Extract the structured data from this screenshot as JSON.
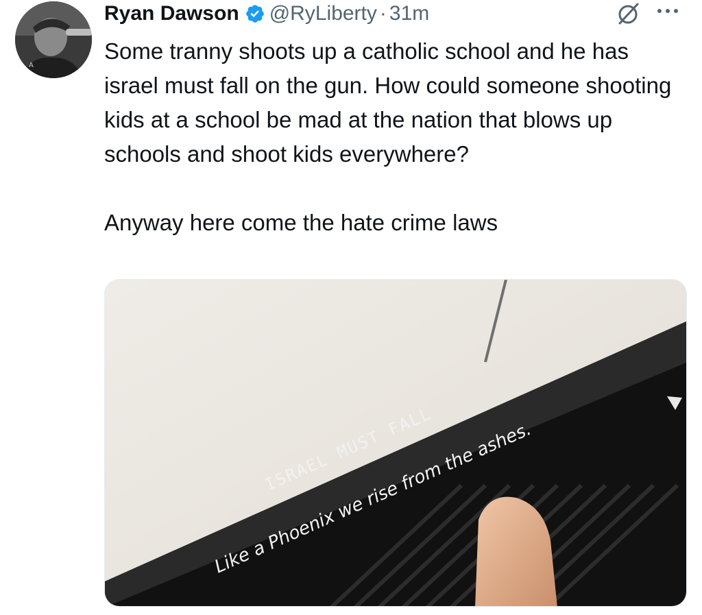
{
  "tweet": {
    "author": {
      "display_name": "Ryan Dawson",
      "handle": "@RyLiberty",
      "verified": true,
      "avatar_icon": "user-avatar"
    },
    "separator": "·",
    "timestamp": "31m",
    "text_paragraphs": [
      "Some tranny shoots up a catholic school and he has israel must fall on the gun. How could someone shooting kids at a school be mad at the nation that blows up schools and shoot kids everywhere?",
      "Anyway here come the hate crime laws"
    ],
    "media": {
      "inscription_line1": "ISRAEL   MUST   FALL",
      "inscription_line2": "Like a Phoenix  we rise  from the ashes."
    },
    "icons": {
      "verified": "verified-badge-icon",
      "grok": "grok-icon",
      "more": "more-options-icon"
    },
    "colors": {
      "text": "#0f1419",
      "secondary": "#536471",
      "verified_blue": "#1d9bf0"
    }
  }
}
